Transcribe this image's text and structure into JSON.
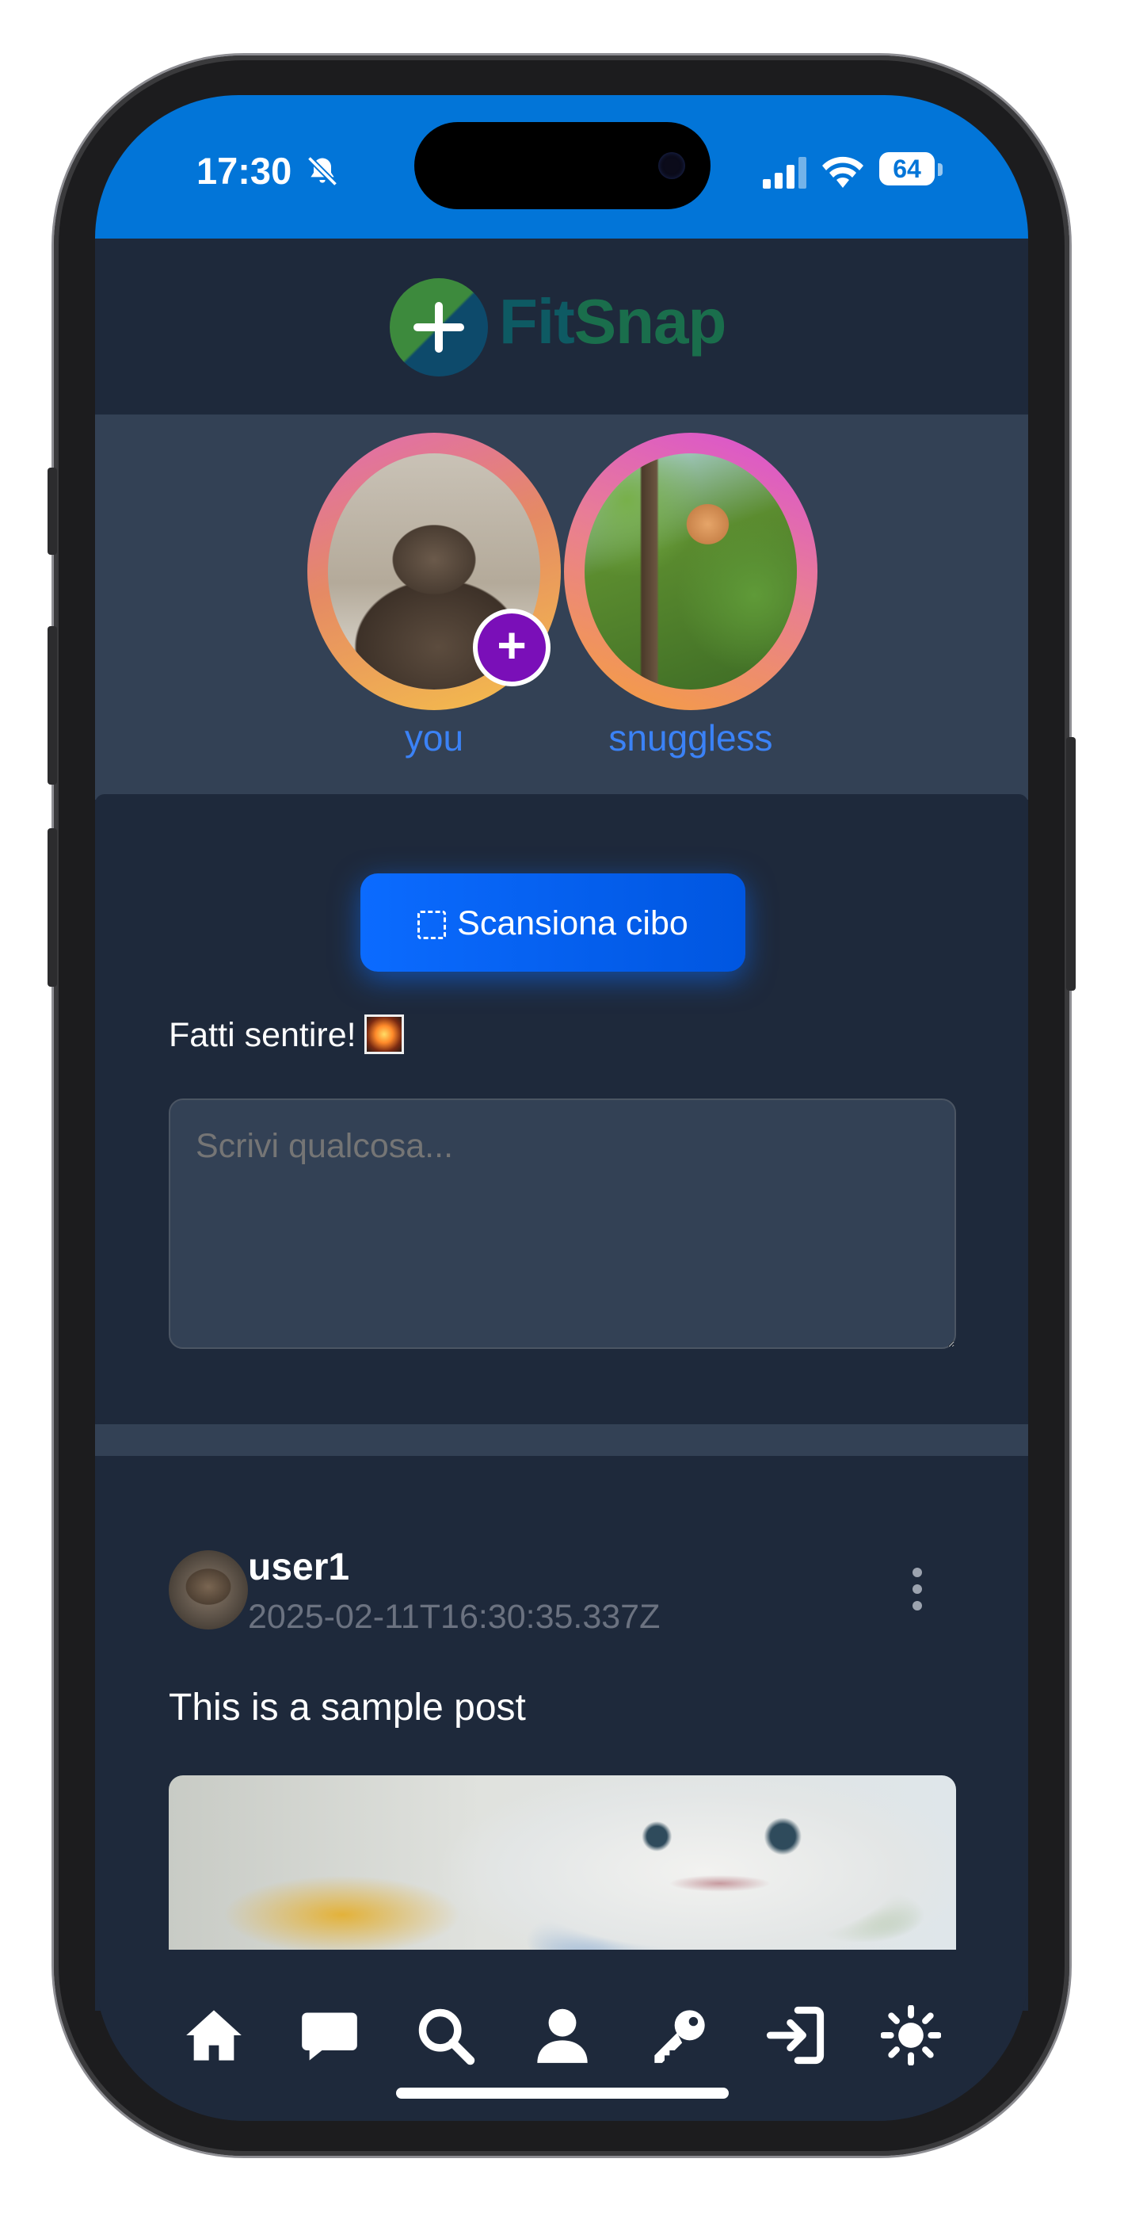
{
  "status_bar": {
    "time": "17:30",
    "battery": "64",
    "icons": [
      "bell-slash-icon",
      "cellular-signal-icon",
      "wifi-icon",
      "battery-icon"
    ]
  },
  "header": {
    "logo_text_a": "Fit",
    "logo_text_b": "Snap"
  },
  "stories": [
    {
      "label": "you"
    },
    {
      "label": "snuggless"
    }
  ],
  "composer": {
    "scan_label": "Scansiona cibo",
    "prompt": "Fatti sentire!",
    "placeholder": "Scrivi qualcosa..."
  },
  "post": {
    "username": "user1",
    "timestamp": "2025-02-11T16:30:35.337Z",
    "text": "This is a sample post"
  },
  "tab_bar": {
    "icons": [
      "home-icon",
      "chat-icon",
      "search-icon",
      "user-icon",
      "key-icon",
      "login-icon",
      "sun-icon"
    ]
  },
  "colors": {
    "status_bar": "#0275d8",
    "background": "#1e293b",
    "panel": "#334155",
    "accent": "#3b82f6",
    "button": "#0b6bff",
    "add_story": "#7a0fb8"
  }
}
